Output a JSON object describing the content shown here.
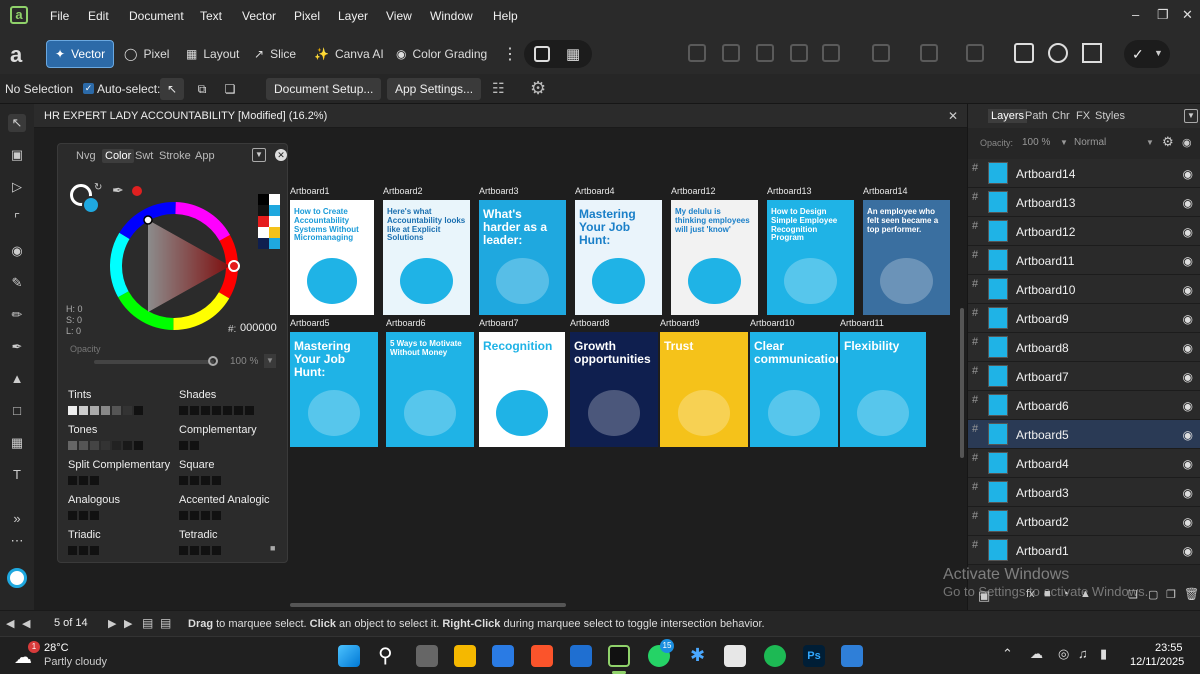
{
  "menu": [
    "File",
    "Edit",
    "Document",
    "Text",
    "Vector",
    "Pixel",
    "Layer",
    "View",
    "Window",
    "Help"
  ],
  "personas": [
    {
      "label": "Vector",
      "active": true
    },
    {
      "label": "Pixel",
      "active": false
    },
    {
      "label": "Layout",
      "active": false
    },
    {
      "label": "Slice",
      "active": false
    },
    {
      "label": "Canva AI",
      "active": false
    },
    {
      "label": "Color Grading",
      "active": false
    }
  ],
  "context": {
    "selection": "No Selection",
    "auto_select": "Auto-select:",
    "doc_setup": "Document Setup...",
    "app_settings": "App Settings..."
  },
  "document": {
    "title": "HR EXPERT LADY ACCOUNTABILITY [Modified] (16.2%)"
  },
  "color_panel": {
    "tabs": [
      "Nvg",
      "Color",
      "Swt",
      "Stroke",
      "App"
    ],
    "active_tab": "Color",
    "hex": "000000",
    "hsl": {
      "h": "H: 0",
      "s": "S: 0",
      "l": "L: 0"
    },
    "opacity_label": "Opacity",
    "opacity_value": "100 %",
    "hex_prefix": "#:",
    "harmonies": [
      "Tints",
      "Shades",
      "Tones",
      "Complementary",
      "Split Complementary",
      "Square",
      "Analogous",
      "Accented Analogic",
      "Triadic",
      "Tetradic"
    ]
  },
  "artboards_row1": [
    {
      "label": "Artboard1",
      "text": "How to Create Accountability Systems Without Micromanaging",
      "bg": "#ffffff",
      "fg": "#1a9bd8"
    },
    {
      "label": "Artboard2",
      "text": "Here's what Accountability looks like at Explicit Solutions",
      "bg": "#e9f5fb",
      "fg": "#1a6fb0"
    },
    {
      "label": "Artboard3",
      "text": "What's harder as a leader:",
      "bg": "#1fa8df",
      "fg": "#ffffff"
    },
    {
      "label": "Artboard4",
      "text": "Mastering Your Job Hunt:",
      "bg": "#eaf4fb",
      "fg": "#1a7fc8"
    },
    {
      "label": "Artboard12",
      "text": "My delulu is thinking employees will just 'know'",
      "bg": "#f2f2f2",
      "fg": "#1a7fc8"
    },
    {
      "label": "Artboard13",
      "text": "How to Design Simple Employee Recognition Program",
      "bg": "#1fb3e6",
      "fg": "#ffffff"
    },
    {
      "label": "Artboard14",
      "text": "An employee who felt seen became a top performer.",
      "bg": "#3a6fa0",
      "fg": "#ffffff"
    }
  ],
  "artboards_row2": [
    {
      "label": "Artboard5",
      "text": "Mastering Your Job Hunt:",
      "bg": "#1fb3e6",
      "fg": "#ffffff"
    },
    {
      "label": "Artboard6",
      "text": "5 Ways to Motivate Without Money",
      "bg": "#1fb3e6",
      "fg": "#ffffff"
    },
    {
      "label": "Artboard7",
      "text": "Recognition",
      "bg": "#ffffff",
      "fg": "#1fb3e6"
    },
    {
      "label": "Artboard8",
      "text": "Growth opportunities",
      "bg": "#0f1f4f",
      "fg": "#ffffff"
    },
    {
      "label": "Artboard9",
      "text": "Trust",
      "bg": "#f5c21a",
      "fg": "#ffffff"
    },
    {
      "label": "Artboard10",
      "text": "Clear communication",
      "bg": "#1fb3e6",
      "fg": "#ffffff"
    },
    {
      "label": "Artboard11",
      "text": "Flexibility",
      "bg": "#1fb3e6",
      "fg": "#ffffff"
    }
  ],
  "layers_panel": {
    "tabs": [
      "Layers",
      "Path",
      "Chr",
      "FX",
      "Styles"
    ],
    "opacity_label": "Opacity:",
    "opacity_value": "100 %",
    "blend_mode": "Normal",
    "layers": [
      "Artboard14",
      "Artboard13",
      "Artboard12",
      "Artboard11",
      "Artboard10",
      "Artboard9",
      "Artboard8",
      "Artboard7",
      "Artboard6",
      "Artboard5",
      "Artboard4",
      "Artboard3",
      "Artboard2",
      "Artboard1"
    ],
    "selected": "Artboard5"
  },
  "watermark": {
    "line1": "Activate Windows",
    "line2": "Go to Settings to activate Windows."
  },
  "status": {
    "page": "5 of 14",
    "hint_b1": "Drag",
    "hint_t1": " to marquee select. ",
    "hint_b2": "Click",
    "hint_t2": " an object to select it. ",
    "hint_b3": "Right-Click",
    "hint_t3": " during marquee select to toggle intersection behavior."
  },
  "taskbar": {
    "weather_temp": "28°C",
    "weather_desc": "Partly cloudy",
    "time": "23:55",
    "date": "12/11/2025",
    "badge_count": "1",
    "whatsapp_badge": "15"
  }
}
